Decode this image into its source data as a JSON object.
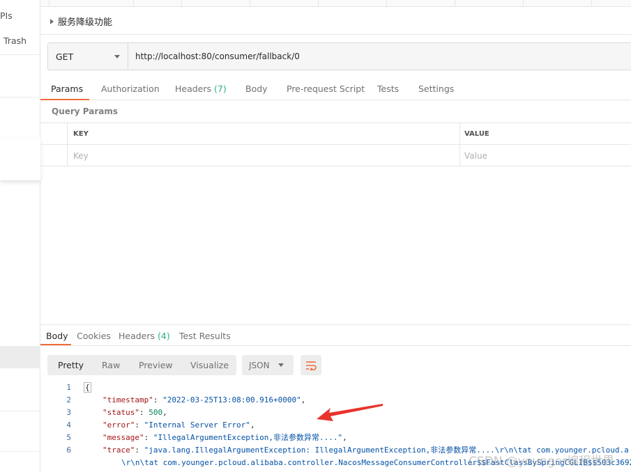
{
  "sidebar": {
    "item_apis_partial": "PIs",
    "item_trash": "Trash"
  },
  "request": {
    "name": "服务降级功能",
    "method": "GET",
    "url": "http://localhost:80/consumer/fallback/0"
  },
  "request_tabs": [
    {
      "label": "Params"
    },
    {
      "label": "Authorization"
    },
    {
      "label": "Headers",
      "count": "(7)"
    },
    {
      "label": "Body"
    },
    {
      "label": "Pre-request Script"
    },
    {
      "label": "Tests"
    },
    {
      "label": "Settings"
    }
  ],
  "query_params": {
    "title": "Query Params",
    "col_key": "KEY",
    "col_value": "VALUE",
    "key_placeholder": "Key",
    "value_placeholder": "Value"
  },
  "response_tabs": [
    {
      "label": "Body"
    },
    {
      "label": "Cookies"
    },
    {
      "label": "Headers",
      "count": "(4)"
    },
    {
      "label": "Test Results"
    }
  ],
  "view_modes": [
    "Pretty",
    "Raw",
    "Preview",
    "Visualize"
  ],
  "format": "JSON",
  "code_lines": [
    {
      "num": "1",
      "parts": [
        {
          "c": "b",
          "t": "{"
        }
      ]
    },
    {
      "num": "2",
      "parts": [
        {
          "c": "k",
          "t": "\"timestamp\""
        },
        {
          "c": "p",
          "t": ": "
        },
        {
          "c": "s",
          "t": "\"2022-03-25T13:08:00.916+0000\""
        },
        {
          "c": "p",
          "t": ","
        }
      ]
    },
    {
      "num": "3",
      "parts": [
        {
          "c": "k",
          "t": "\"status\""
        },
        {
          "c": "p",
          "t": ": "
        },
        {
          "c": "n",
          "t": "500"
        },
        {
          "c": "p",
          "t": ","
        }
      ]
    },
    {
      "num": "4",
      "parts": [
        {
          "c": "k",
          "t": "\"error\""
        },
        {
          "c": "p",
          "t": ": "
        },
        {
          "c": "s",
          "t": "\"Internal Server Error\""
        },
        {
          "c": "p",
          "t": ","
        }
      ]
    },
    {
      "num": "5",
      "parts": [
        {
          "c": "k",
          "t": "\"message\""
        },
        {
          "c": "p",
          "t": ": "
        },
        {
          "c": "s",
          "t": "\"IllegalArgumentException,非法参数异常....\""
        },
        {
          "c": "p",
          "t": ","
        }
      ]
    },
    {
      "num": "6",
      "parts": [
        {
          "c": "k",
          "t": "\"trace\""
        },
        {
          "c": "p",
          "t": ": "
        },
        {
          "c": "s",
          "t": "\"java.lang.IllegalArgumentException: IllegalArgumentException,非法参数异常....\\r\\n\\tat com.younger.pcloud.a"
        }
      ]
    },
    {
      "num": "",
      "parts": [
        {
          "c": "s",
          "t": "\\r\\n\\tat com.younger.pcloud.alibaba.controller.NacosMessageConsumerController$$FastClassBySpringCGLIB$$503c3692"
        }
      ]
    }
  ],
  "watermark": "CSDN @younger编程世界",
  "colors": {
    "accent": "#f26b3a",
    "count_green": "#26b47f",
    "json_key": "#a31515",
    "json_string": "#0451a5",
    "json_number": "#098658",
    "annotation_arrow": "#e8322b"
  },
  "icons": {
    "expand": "caret-right-icon",
    "method_dropdown": "chevron-down-icon",
    "format_dropdown": "chevron-down-icon",
    "wrap": "wrap-lines-icon"
  }
}
